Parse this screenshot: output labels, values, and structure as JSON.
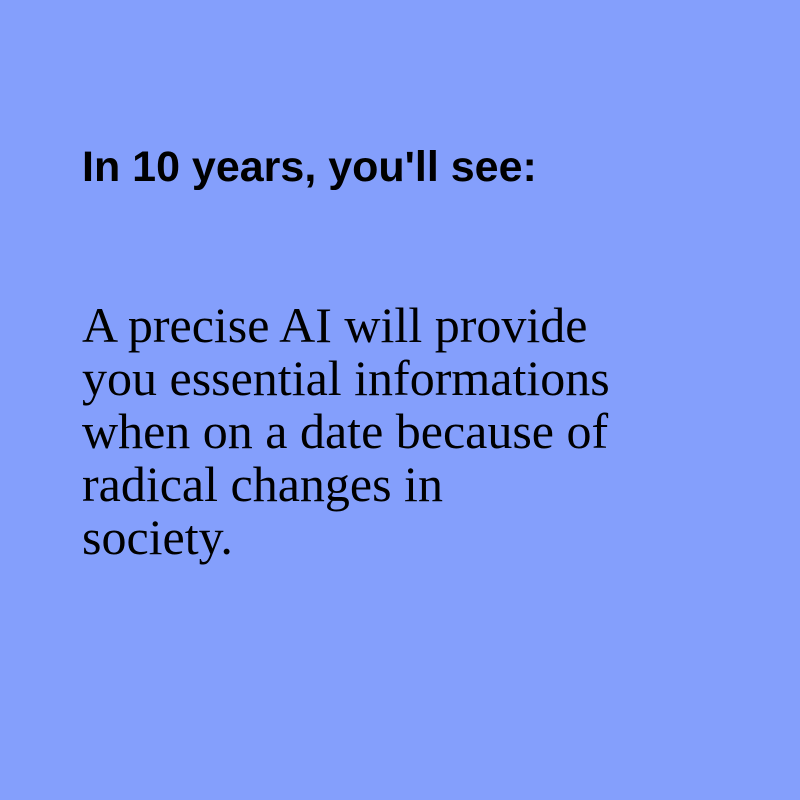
{
  "colors": {
    "background": "#849ffc",
    "text": "#000000"
  },
  "heading": "In 10 years, you'll see:",
  "body_lines": [
    "A precise AI will provide",
    "you essential informations",
    "when on a date because of",
    "radical changes in",
    "society."
  ]
}
